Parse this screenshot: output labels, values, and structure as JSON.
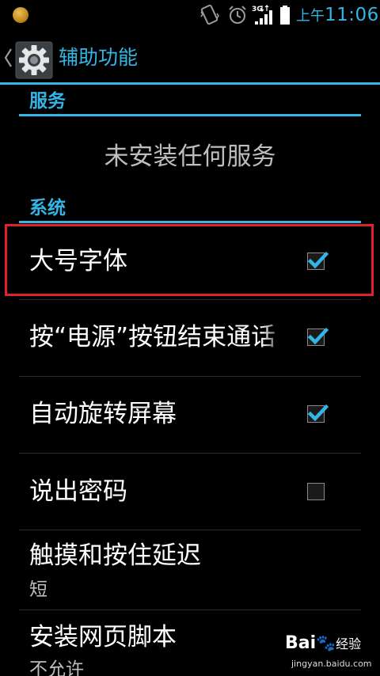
{
  "status_bar": {
    "ampm": "上午",
    "time": "11:06",
    "network_label": "3G",
    "accent_color": "#33b5e5"
  },
  "action_bar": {
    "title": "辅助功能",
    "icon": "gear-icon"
  },
  "sections": {
    "services": {
      "header": "服务",
      "empty_text": "未安装任何服务"
    },
    "system": {
      "header": "系统",
      "items": [
        {
          "title": "大号字体",
          "checked": true
        },
        {
          "title": "按“电源”按钮结束通话",
          "checked": true
        },
        {
          "title": "自动旋转屏幕",
          "checked": true
        },
        {
          "title": "说出密码",
          "checked": false
        },
        {
          "title": "触摸和按住延迟",
          "summary": "短"
        },
        {
          "title": "安装网页脚本",
          "summary": "不允许"
        }
      ]
    }
  },
  "highlight_color": "#e0222a",
  "watermark": {
    "logo": "Bai 度 经验",
    "url": "jingyan.baidu.com"
  }
}
